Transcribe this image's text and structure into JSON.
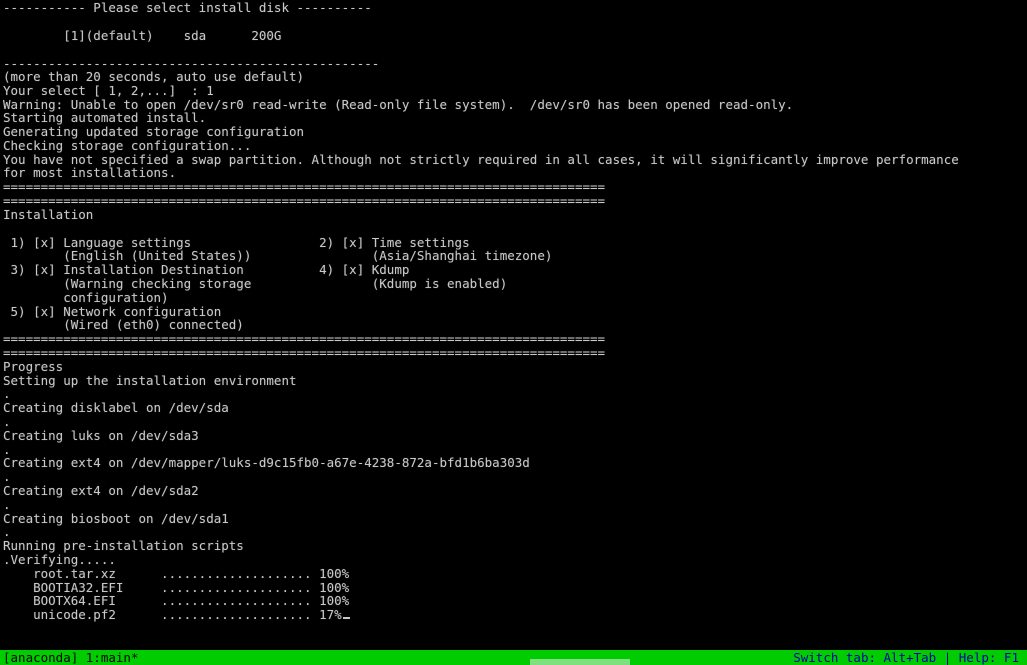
{
  "terminal": {
    "lines": [
      "----------- Please select install disk ----------",
      "",
      "        [1](default)    sda      200G",
      "",
      "--------------------------------------------------",
      "(more than 20 seconds, auto use default)",
      "Your select [ 1, 2,...]  : 1",
      "Warning: Unable to open /dev/sr0 read-write (Read-only file system).  /dev/sr0 has been opened read-only.",
      "Starting automated install.",
      "Generating updated storage configuration",
      "Checking storage configuration...",
      "You have not specified a swap partition. Although not strictly required in all cases, it will significantly improve performance",
      "for most installations.",
      "================================================================================",
      "================================================================================",
      "Installation",
      "",
      " 1) [x] Language settings                 2) [x] Time settings",
      "        (English (United States))                (Asia/Shanghai timezone)",
      " 3) [x] Installation Destination          4) [x] Kdump",
      "        (Warning checking storage                (Kdump is enabled)",
      "        configuration)",
      " 5) [x] Network configuration",
      "        (Wired (eth0) connected)",
      "================================================================================",
      "================================================================================",
      "Progress",
      "Setting up the installation environment",
      ".",
      "Creating disklabel on /dev/sda",
      ".",
      "Creating luks on /dev/sda3",
      ".",
      "Creating ext4 on /dev/mapper/luks-d9c15fb0-a67e-4238-872a-bfd1b6ba303d",
      ".",
      "Creating ext4 on /dev/sda2",
      ".",
      "Creating biosboot on /dev/sda1",
      ".",
      "Running pre-installation scripts",
      ".Verifying.....",
      "    root.tar.xz      .................... 100%",
      "    BOOTIA32.EFI     .................... 100%",
      "    BOOTX64.EFI      .................... 100%",
      "    unicode.pf2      .................... 17%"
    ]
  },
  "statusbar": {
    "left": "[anaconda] 1:main*",
    "right": "Switch tab: Alt+Tab | Help: F1"
  },
  "colors": {
    "terminal_bg": "#000000",
    "terminal_fg": "#c8c8c8",
    "statusbar_bg": "#00cc00",
    "statusbar_left_fg": "#000000",
    "statusbar_right_fg": "#0000aa"
  }
}
